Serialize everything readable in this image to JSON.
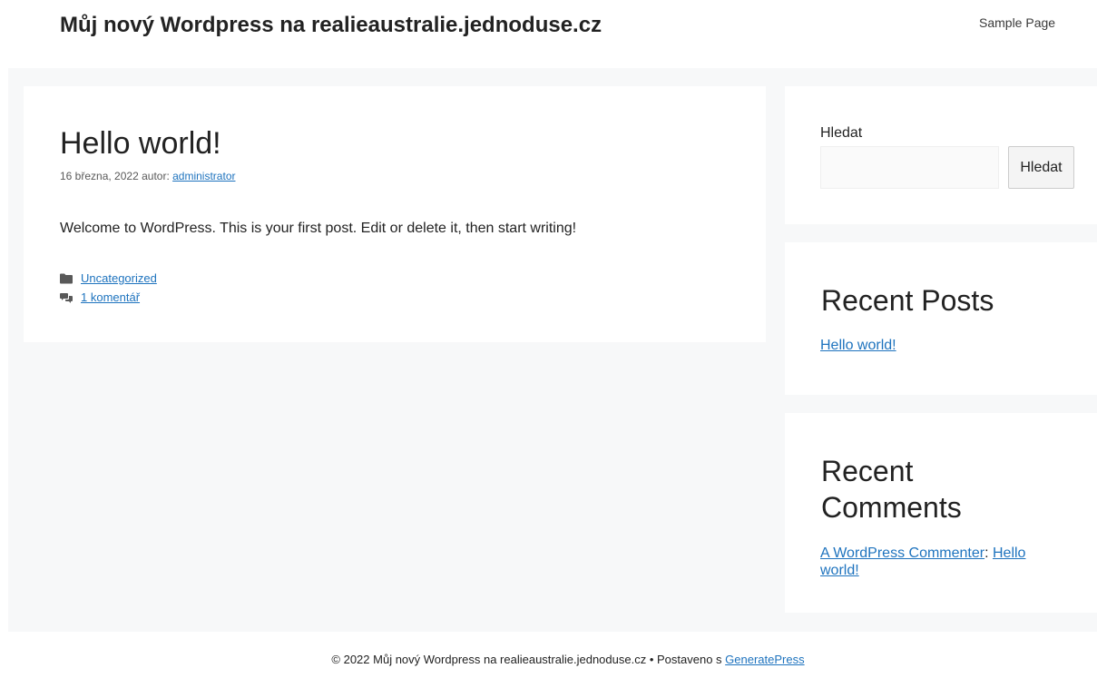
{
  "header": {
    "site_title": "Můj nový Wordpress na realieaustralie.jednoduse.cz",
    "nav": [
      "Sample Page"
    ]
  },
  "post": {
    "title": "Hello world!",
    "date": "16 března, 2022",
    "author_prefix": "autor:",
    "author": "administrator",
    "body": "Welcome to WordPress. This is your first post. Edit or delete it, then start writing!",
    "category": "Uncategorized",
    "comments_link": "1 komentář",
    "category_icon": "folder-icon",
    "comments_icon": "comments-icon"
  },
  "sidebar": {
    "search": {
      "label": "Hledat",
      "button": "Hledat",
      "value": "",
      "placeholder": ""
    },
    "recent_posts": {
      "title": "Recent Posts",
      "items": [
        "Hello world!"
      ]
    },
    "recent_comments": {
      "title": "Recent Comments",
      "items": [
        {
          "author": "A WordPress Commenter",
          "separator": ": ",
          "post": "Hello world!"
        }
      ]
    }
  },
  "footer": {
    "copyright": "© 2022 Můj nový Wordpress na realieaustralie.jednoduse.cz • Postaveno s",
    "link": "GeneratePress"
  },
  "colors": {
    "link": "#1e73be",
    "content_background": "#f7f8f9",
    "text": "#222222"
  }
}
